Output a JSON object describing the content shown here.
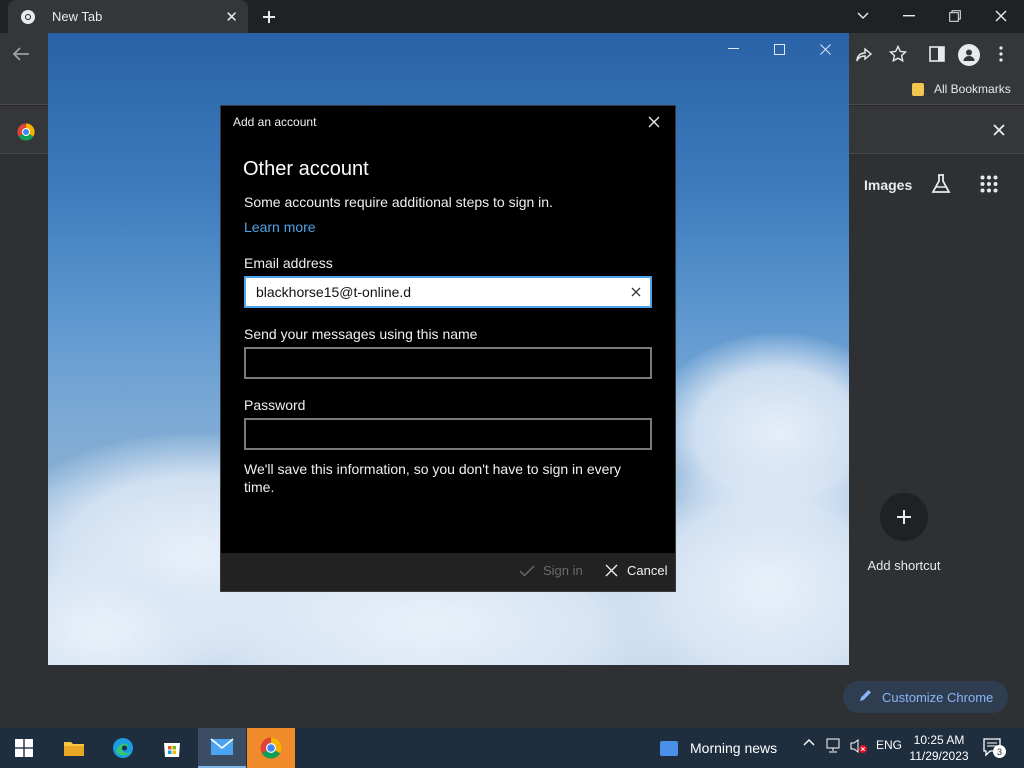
{
  "browser": {
    "tab_title": "New Tab",
    "bookmarks_all": "All Bookmarks",
    "ntp": {
      "images_link": "Images",
      "add_shortcut_label": "Add shortcut",
      "customize_label": "Customize Chrome"
    },
    "colors": {
      "frame": "#202124",
      "toolbar": "#35363a",
      "ntp_bg": "#2f3033",
      "accent": "#8ab4f8"
    }
  },
  "dialog": {
    "window_title": "Add an account",
    "heading": "Other account",
    "description": "Some accounts require additional steps to sign in.",
    "learn_more": "Learn more",
    "email_label": "Email address",
    "email_value": "blackhorse15@t-online.d",
    "name_label": "Send your messages using this name",
    "name_value": "",
    "password_label": "Password",
    "password_value": "",
    "note": "We'll save this information, so you don't have to sign in every time.",
    "signin_label": "Sign in",
    "cancel_label": "Cancel",
    "colors": {
      "bg": "#000000",
      "link": "#4ea2e8",
      "footer": "#222222"
    }
  },
  "taskbar": {
    "news_label": "Morning news",
    "language": "ENG",
    "time": "10:25 AM",
    "date": "11/29/2023",
    "notification_count": "3",
    "icons": [
      "windows-start-icon",
      "file-explorer-icon",
      "edge-icon",
      "microsoft-store-icon",
      "mail-icon",
      "chrome-icon"
    ]
  }
}
